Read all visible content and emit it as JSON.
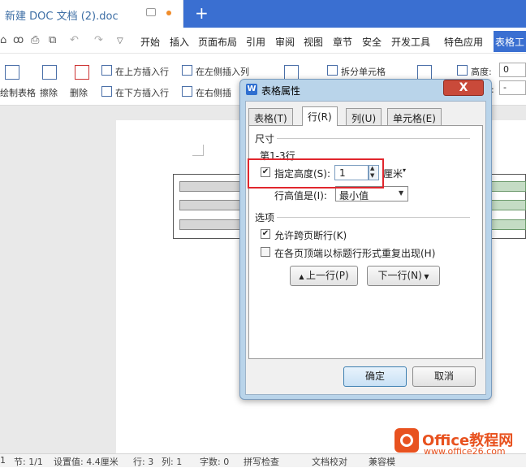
{
  "titlebar": {
    "doc_title": "新建 DOC 文档 (2).doc",
    "new_tab": "+"
  },
  "menu": {
    "items": [
      "开始",
      "插入",
      "页面布局",
      "引用",
      "审阅",
      "视图",
      "章节",
      "安全",
      "开发工具",
      "特色应用"
    ],
    "table_tools": "表格工"
  },
  "ribbon": {
    "draw_table": "绘制表格",
    "eraser": "擦除",
    "delete": "删除",
    "insert_above": "在上方插入行",
    "insert_left": "在左侧插入列",
    "insert_below": "在下方插入行",
    "insert_right": "在右侧插",
    "split_cells": "拆分单元格",
    "height_label": "高度:",
    "width_label": "度:",
    "height_value": "0",
    "width_value": "-"
  },
  "dialog": {
    "title": "表格属性",
    "close": "X",
    "tabs": [
      "表格(T)",
      "行(R)",
      "列(U)",
      "单元格(E)"
    ],
    "active_tab": 1,
    "size_section": "尺寸",
    "row_range": "第1-3行",
    "specify_height_label": "指定高度(S):",
    "specify_height_checked": true,
    "height_value": "1",
    "unit": "厘米",
    "row_height_is_label": "行高值是(I):",
    "row_height_mode": "最小值",
    "options_section": "选项",
    "allow_break_label": "允许跨页断行(K)",
    "allow_break_checked": true,
    "repeat_header_label": "在各页顶端以标题行形式重复出现(H)",
    "repeat_header_checked": false,
    "prev_row_button": "上一行(P)",
    "next_row_button": "下一行(N)",
    "ok_button": "确定",
    "cancel_button": "取消"
  },
  "statusbar": {
    "page": "1",
    "section": "节: 1/1",
    "setting": "设置值: 4.4厘米",
    "row": "行: 3",
    "col": "列: 1",
    "words": "字数: 0",
    "spell": "拼写检查",
    "doc_check": "文档校对",
    "compat": "兼容模"
  },
  "watermark": {
    "title": "Office教程网",
    "url": "www.office26.com"
  },
  "colors": {
    "accent": "#3a6fd1",
    "highlight": "#e1262d",
    "watermark": "#e8521f"
  }
}
